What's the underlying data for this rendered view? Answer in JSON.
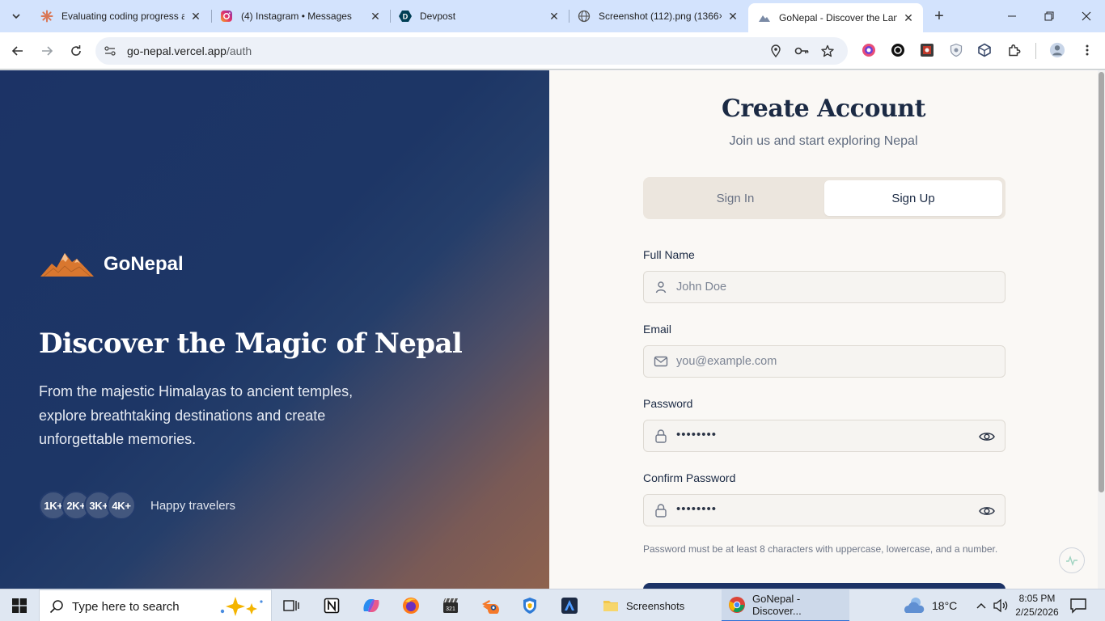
{
  "browser": {
    "tabs": [
      {
        "title": "Evaluating coding progress a",
        "icon": "claude-asterisk-icon",
        "active": false
      },
      {
        "title": "(4) Instagram • Messages",
        "icon": "instagram-icon",
        "active": false
      },
      {
        "title": "Devpost",
        "icon": "devpost-icon",
        "active": false
      },
      {
        "title": "Screenshot (112).png (1366×",
        "icon": "globe-icon",
        "active": false
      },
      {
        "title": "GoNepal - Discover the Land",
        "icon": "gonepal-icon",
        "active": true
      }
    ],
    "url_host": "go-nepal.vercel.app",
    "url_path": "/auth"
  },
  "hero": {
    "brand": "GoNepal",
    "title": "Discover the Magic of Nepal",
    "description": "From the majestic Himalayas to ancient temples, explore breathtaking destinations and create unforgettable memories.",
    "travelers": [
      "1K+",
      "2K+",
      "3K+",
      "4K+"
    ],
    "travelers_label": "Happy travelers"
  },
  "auth": {
    "title": "Create Account",
    "subtitle": "Join us and start exploring Nepal",
    "tabs": {
      "sign_in": "Sign In",
      "sign_up": "Sign Up",
      "active": "sign_up"
    },
    "fields": {
      "full_name": {
        "label": "Full Name",
        "placeholder": "John Doe"
      },
      "email": {
        "label": "Email",
        "placeholder": "you@example.com"
      },
      "password": {
        "label": "Password",
        "value": "••••••••"
      },
      "confirm_password": {
        "label": "Confirm Password",
        "value": "••••••••"
      }
    },
    "hint": "Password must be at least 8 characters with uppercase, lowercase, and a number."
  },
  "taskbar": {
    "search_placeholder": "Type here to search",
    "windows": [
      {
        "label": "Screenshots",
        "icon": "folder-icon",
        "active": false
      },
      {
        "label": "GoNepal - Discover...",
        "icon": "chrome-icon",
        "active": true
      }
    ],
    "weather": "18°C",
    "time": "8:05 PM",
    "date": "2/25/2026"
  },
  "colors": {
    "hero_start": "#1c3366",
    "hero_end": "#8e624e",
    "auth_bg": "#faf8f5",
    "accent": "#1c3366",
    "brand_orange": "#d9772f"
  }
}
